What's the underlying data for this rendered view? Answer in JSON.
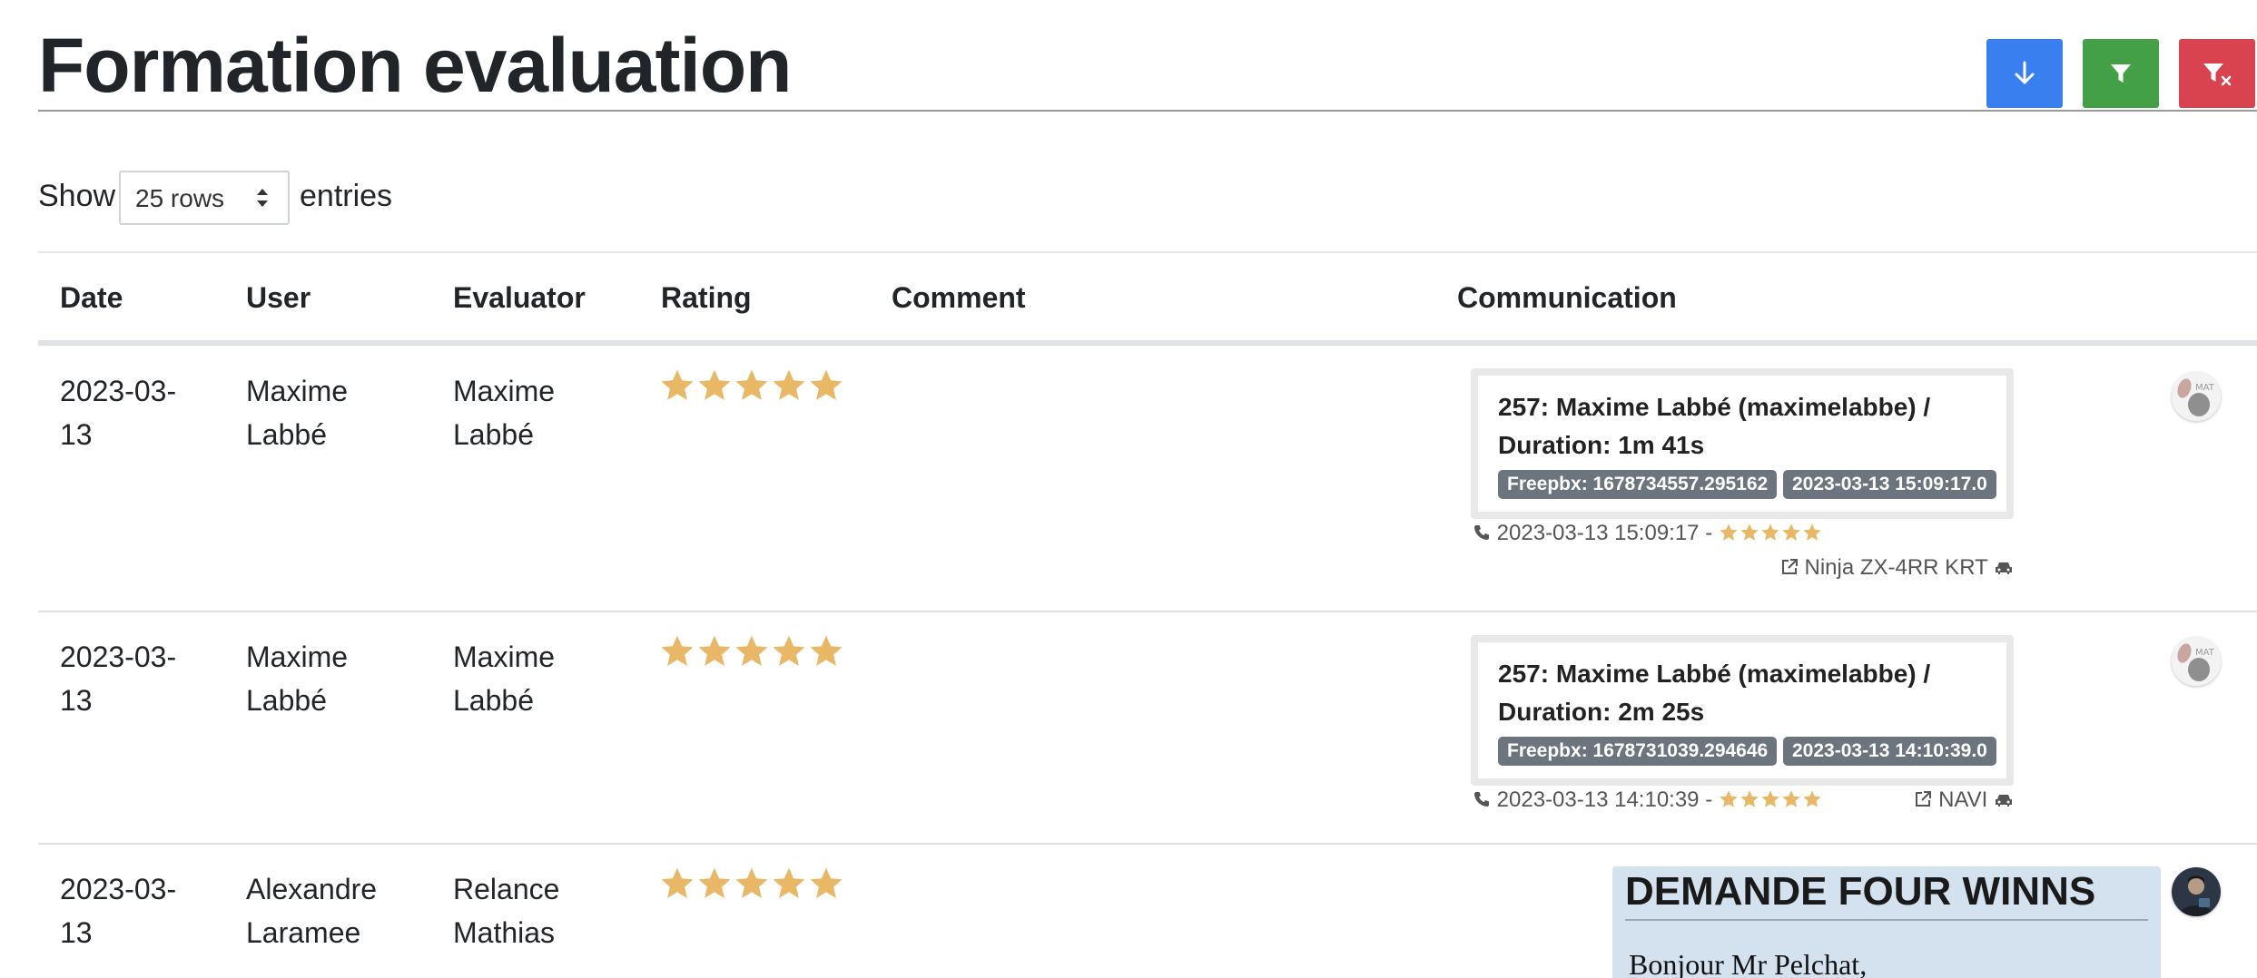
{
  "page": {
    "title": "Formation evaluation"
  },
  "toolbar": {
    "download_icon": "arrow-down-icon",
    "filter_icon": "filter-icon",
    "clear_filter_icon": "filter-clear-icon",
    "colors": {
      "download": "#3a7ff0",
      "filter": "#43a047",
      "clear": "#d94350"
    }
  },
  "length_menu": {
    "show_label": "Show",
    "selected": "25 rows",
    "entries_label": "entries"
  },
  "table": {
    "columns": [
      "Date",
      "User",
      "Evaluator",
      "Rating",
      "Comment",
      "Communication"
    ],
    "star_color": "#e8b866",
    "rows": [
      {
        "date_line1": "2023-03-",
        "date_line2": "13",
        "user_line1": "Maxime",
        "user_line2": "Labbé",
        "evaluator_line1": "Maxime",
        "evaluator_line2": "Labbé",
        "rating": 5,
        "comment": "",
        "communication": {
          "title_line1": "257: Maxime Labbé (maximelabbe) /",
          "title_line2": "Duration: 1m 41s",
          "badge_source": "Freepbx: 1678734557.295162",
          "badge_time": "2023-03-13 15:09:17.0",
          "call_time": "2023-03-13 15:09:17 -",
          "call_rating": 5,
          "vehicle": "Ninja ZX-4RR KRT"
        }
      },
      {
        "date_line1": "2023-03-",
        "date_line2": "13",
        "user_line1": "Maxime",
        "user_line2": "Labbé",
        "evaluator_line1": "Maxime",
        "evaluator_line2": "Labbé",
        "rating": 5,
        "comment": "",
        "communication": {
          "title_line1": "257: Maxime Labbé (maximelabbe) /",
          "title_line2": "Duration: 2m 25s",
          "badge_source": "Freepbx: 1678731039.294646",
          "badge_time": "2023-03-13 14:10:39.0",
          "call_time": "2023-03-13 14:10:39 -",
          "call_rating": 5,
          "vehicle": "NAVI"
        }
      },
      {
        "date_line1": "2023-03-",
        "date_line2": "13",
        "user_line1": "Alexandre",
        "user_line2": "Laramee",
        "evaluator_line1": "Relance",
        "evaluator_line2": "Mathias",
        "rating": 5,
        "comment": "",
        "communication": {
          "email_subject": "DEMANDE FOUR WINNS",
          "email_greeting": "Bonjour Mr Pelchat,"
        }
      }
    ]
  }
}
